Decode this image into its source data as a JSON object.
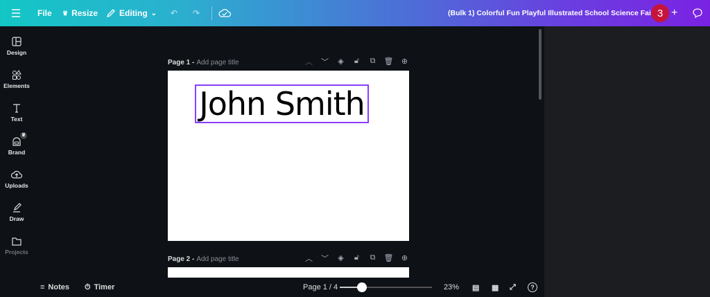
{
  "topbar": {
    "file": "File",
    "resize": "Resize",
    "editing": "Editing",
    "title": "(Bulk 1) Colorful Fun Playful Illustrated School Science Fair ...",
    "collab_count": "3"
  },
  "sidebar": {
    "items": [
      {
        "label": "Design"
      },
      {
        "label": "Elements"
      },
      {
        "label": "Text"
      },
      {
        "label": "Brand"
      },
      {
        "label": "Uploads"
      },
      {
        "label": "Draw"
      },
      {
        "label": "Projects"
      }
    ]
  },
  "pages": [
    {
      "label": "Page 1 -",
      "title_placeholder": "Add page title",
      "text": "John Smith"
    },
    {
      "label": "Page 2 -",
      "title_placeholder": "Add page title"
    }
  ],
  "bottombar": {
    "notes": "Notes",
    "timer": "Timer",
    "page_indicator": "Page 1 / 4",
    "zoom": "23%",
    "zoom_slider_fraction": 0.24
  },
  "colors": {
    "selection": "#8b3dff",
    "badge": "#c7143a"
  }
}
